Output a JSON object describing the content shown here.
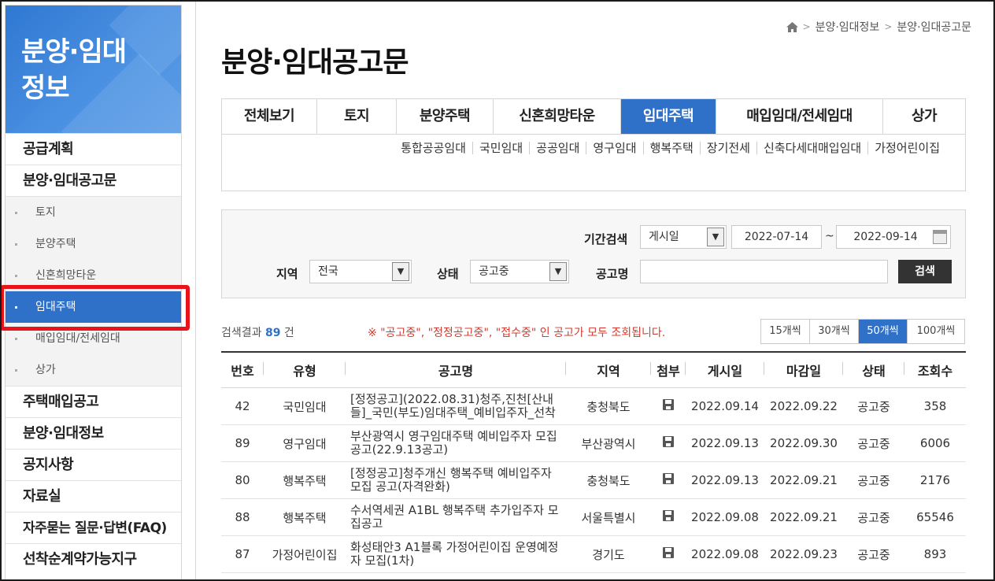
{
  "sidebar": {
    "title": "분양·임대\n정보",
    "items_top": [
      "공급계획",
      "분양·임대공고문"
    ],
    "sub_items": [
      "토지",
      "분양주택",
      "신혼희망타운",
      "임대주택",
      "매입임대/전세임대",
      "상가"
    ],
    "items_bottom": [
      "주택매입공고",
      "분양·임대정보",
      "공지사항",
      "자료실",
      "자주묻는 질문·답변(FAQ)",
      "선착순계약가능지구"
    ],
    "active_sub": "임대주택"
  },
  "breadcrumb": {
    "level1": "분양·임대정보",
    "level2": "분양·임대공고문",
    "home_icon": "home-icon"
  },
  "page_title": "분양·임대공고문",
  "tabs": [
    "전체보기",
    "토지",
    "분양주택",
    "신혼희망타운",
    "임대주택",
    "매입임대/전세임대",
    "상가"
  ],
  "active_tab": "임대주택",
  "subtabs": [
    "통합공공임대",
    "국민임대",
    "공공임대",
    "영구임대",
    "행복주택",
    "장기전세",
    "신축다세대매입임대",
    "가정어린이집"
  ],
  "search": {
    "period_label": "기간검색",
    "period_select": "게시일",
    "date_from": "2022-07-14",
    "tilde": "~",
    "date_to": "2022-09-14",
    "region_label": "지역",
    "region_select": "전국",
    "status_label": "상태",
    "status_select": "공고중",
    "name_label": "공고명",
    "name_value": "",
    "button": "검색"
  },
  "results": {
    "prefix": "검색결과",
    "count": "89",
    "suffix": "건",
    "notice": "※ \"공고중\", \"정정공고중\", \"접수중\" 인 공고가 모두 조회됩니다."
  },
  "page_size": [
    "15개씩",
    "30개씩",
    "50개씩",
    "100개씩"
  ],
  "active_page_size": "50개씩",
  "table": {
    "headers": [
      "번호",
      "유형",
      "공고명",
      "지역",
      "첨부",
      "게시일",
      "마감일",
      "상태",
      "조회수"
    ],
    "rows": [
      {
        "no": "42",
        "type": "국민임대",
        "title": "[정정공고](2022.08.31)청주,진천[산내들]_국민(부도)임대주택_예비입주자_선착",
        "region": "충청북도",
        "attach": "disk-icon",
        "posted": "2022.09.14",
        "deadline": "2022.09.22",
        "status": "공고중",
        "views": "358"
      },
      {
        "no": "89",
        "type": "영구임대",
        "title": "부산광역시 영구임대주택 예비입주자 모집공고(22.9.13공고)",
        "region": "부산광역시",
        "attach": "disk-icon",
        "posted": "2022.09.13",
        "deadline": "2022.09.30",
        "status": "공고중",
        "views": "6006"
      },
      {
        "no": "80",
        "type": "행복주택",
        "title": "[정정공고]청주개신 행복주택 예비입주자 모집 공고(자격완화)",
        "region": "충청북도",
        "attach": "disk-icon",
        "posted": "2022.09.13",
        "deadline": "2022.09.21",
        "status": "공고중",
        "views": "2176"
      },
      {
        "no": "88",
        "type": "행복주택",
        "title": "수서역세권 A1BL 행복주택 추가입주자 모집공고",
        "region": "서울특별시",
        "attach": "disk-icon",
        "posted": "2022.09.08",
        "deadline": "2022.09.21",
        "status": "공고중",
        "views": "65546"
      },
      {
        "no": "87",
        "type": "가정어린이집",
        "title": "화성태안3 A1블록 가정어린이집 운영예정자 모집(1차)",
        "region": "경기도",
        "attach": "disk-icon",
        "posted": "2022.09.08",
        "deadline": "2022.09.23",
        "status": "공고중",
        "views": "893"
      }
    ]
  },
  "colors": {
    "brand_blue": "#2f70c9",
    "notice_red": "#d63a2f",
    "highlight_red": "#e8131b"
  }
}
